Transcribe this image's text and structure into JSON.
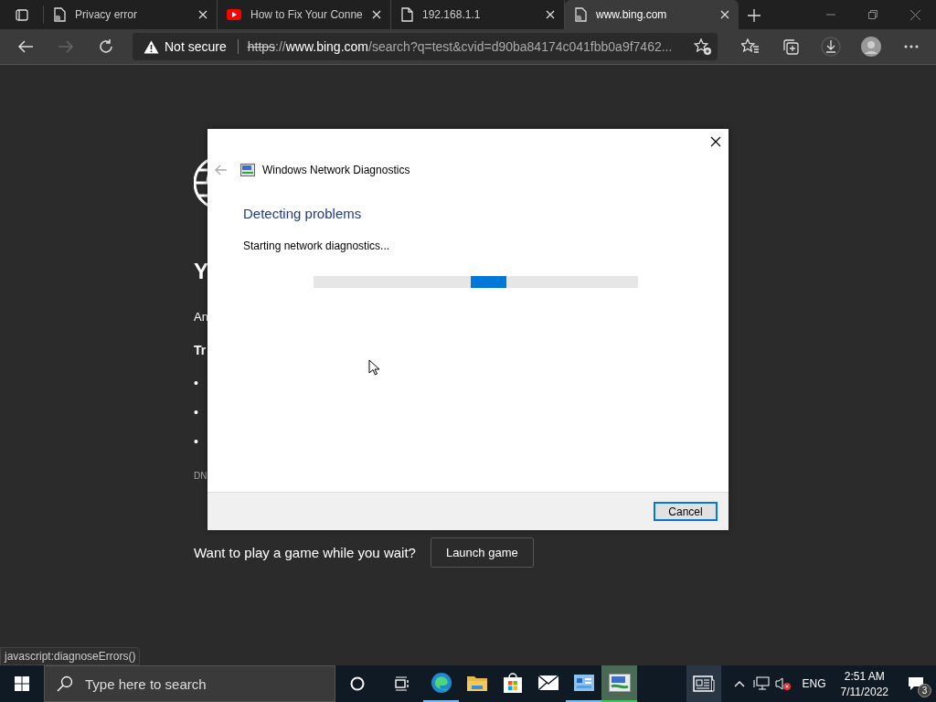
{
  "browser": {
    "tabs": [
      {
        "title": "Privacy error",
        "kind": "error-page",
        "selected": false
      },
      {
        "title": "How to Fix Your Conne",
        "kind": "video",
        "selected": false
      },
      {
        "title": "192.168.1.1",
        "kind": "page",
        "selected": false
      },
      {
        "title": "www.bing.com",
        "kind": "error-page",
        "selected": true
      }
    ],
    "nav": [
      {
        "kind": "back",
        "disabled": false
      },
      {
        "kind": "forward",
        "disabled": true
      },
      {
        "kind": "refresh",
        "disabled": false
      }
    ],
    "address": {
      "security": "Not secure",
      "scheme": "https",
      "separator": "://",
      "host": "www.bing.com",
      "path": "/search?q=test&cvid=d90ba84174c041fbb0a9f7462..."
    },
    "status_url": "javascript:diagnoseErrors()"
  },
  "error_page": {
    "heading": "Y",
    "text": "An",
    "subheading": "Tr",
    "bullets": [
      "•",
      "•",
      "•"
    ],
    "code": "DN",
    "game_prompt": "Want to play a game while you wait?",
    "game_button": "Launch game"
  },
  "dialog": {
    "title": "Windows Network Diagnostics",
    "heading": "Detecting problems",
    "status": "Starting network diagnostics...",
    "progress": {
      "indeterminate": true
    },
    "buttons": [
      "Cancel"
    ]
  },
  "taskbar": {
    "search": {
      "placeholder": "Type here to search"
    },
    "apps": [
      {
        "kind": "edge",
        "running": true,
        "active": false
      },
      {
        "kind": "folder",
        "running": false,
        "active": false
      },
      {
        "kind": "store",
        "running": false,
        "active": false
      },
      {
        "kind": "mail",
        "running": false,
        "active": false
      },
      {
        "kind": "control-panel",
        "running": true,
        "active": false
      },
      {
        "kind": "diagnostics",
        "running": true,
        "active": true
      }
    ],
    "language": "ENG",
    "time": "2:51 AM",
    "date": "7/11/2022",
    "notifications": "3"
  }
}
